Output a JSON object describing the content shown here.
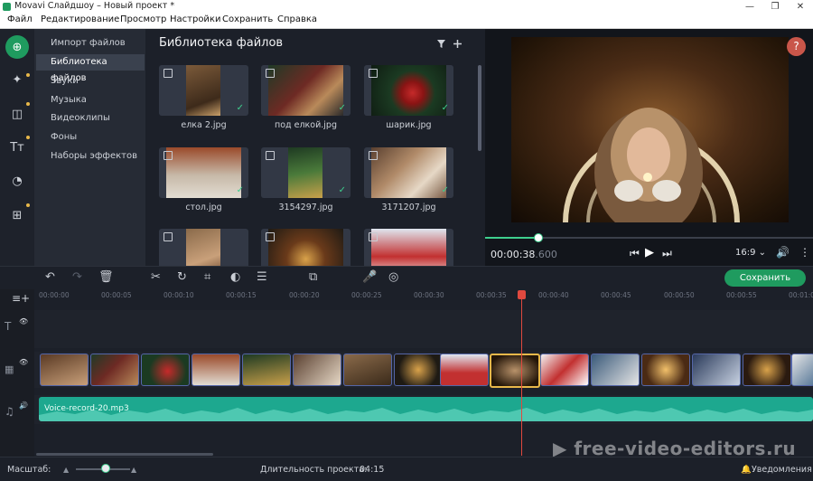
{
  "titlebar": {
    "title": "Movavi Слайдшоу – Новый проект *",
    "min": "—",
    "max": "❐",
    "close": "✕"
  },
  "menu": [
    "Файл",
    "Редактирование",
    "Просмотр",
    "Настройки",
    "Сохранить",
    "Справка"
  ],
  "categories": [
    "Импорт файлов",
    "Библиотека файлов",
    "Звуки",
    "Музыка",
    "Видеоклипы",
    "Фоны",
    "Наборы эффектов"
  ],
  "library": {
    "title": "Библиотека файлов",
    "files": [
      {
        "name": "елка 2.jpg",
        "checked": true
      },
      {
        "name": "под елкой.jpg",
        "checked": true
      },
      {
        "name": "шарик.jpg",
        "checked": true
      },
      {
        "name": "стол.jpg",
        "checked": true
      },
      {
        "name": "3154297.jpg",
        "checked": true
      },
      {
        "name": "3171207.jpg",
        "checked": true
      },
      {
        "name": "",
        "checked": false
      },
      {
        "name": "",
        "checked": false
      },
      {
        "name": "",
        "checked": false
      }
    ]
  },
  "preview": {
    "help": "?",
    "time_main": "00:00:38",
    "time_frac": ".600",
    "aspect": "16:9",
    "progress": 0.16
  },
  "toolbar": {
    "save_label": "Сохранить"
  },
  "timeline": {
    "ticks": [
      "00:00:00",
      "00:00:05",
      "00:00:10",
      "00:00:15",
      "00:00:20",
      "00:00:25",
      "00:00:30",
      "00:00:35",
      "00:00:40",
      "00:00:45",
      "00:00:50",
      "00:00:55",
      "00:01:0"
    ],
    "audio_clip": "Voice-record-20.mp3"
  },
  "status": {
    "scale_label": "Масштаб:",
    "duration_label": "Длительность проекта:",
    "duration_value": "04:15",
    "notifications": "Уведомления"
  },
  "watermark": "free-video-editors.ru",
  "colors": {
    "accent": "#1f9b5f",
    "audio": "#1da88f",
    "playhead": "#e0493f",
    "selected_clip": "#e8b84a"
  }
}
